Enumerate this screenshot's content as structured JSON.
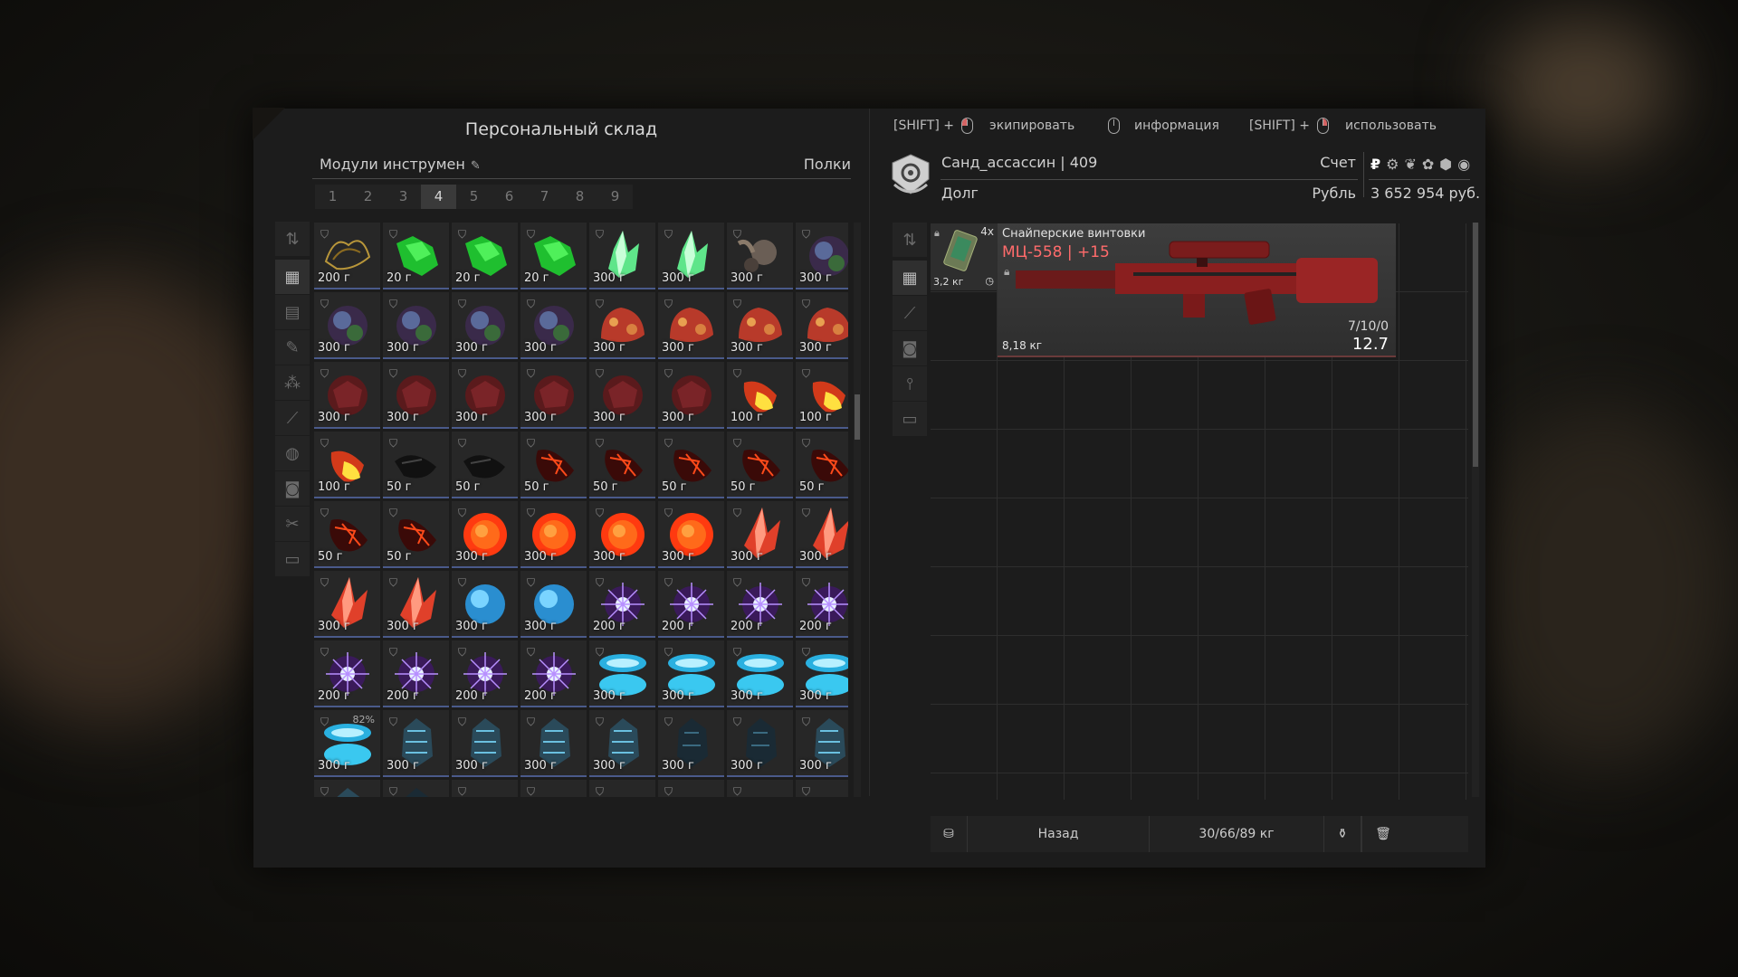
{
  "storage": {
    "title": "Персональный склад",
    "folder_name": "Модули инструмен",
    "shelves_label": "Полки",
    "pages": [
      "1",
      "2",
      "3",
      "4",
      "5",
      "6",
      "7",
      "8",
      "9"
    ],
    "active_page": "4"
  },
  "hints": {
    "equip_mod": "[SHIFT] +",
    "equip": "экипировать",
    "info": "информация",
    "use_mod": "[SHIFT] +",
    "use": "использовать"
  },
  "account": {
    "username": "Санд_ассассин | 409",
    "account_label": "Счет",
    "debt_label": "Долг",
    "currency_name": "Рубль",
    "balance": "3 652 954 руб.",
    "currency_symbol": "₽"
  },
  "equipped": {
    "small_item": {
      "qty": "4x",
      "weight": "3,2 кг"
    },
    "weapon": {
      "category": "Снайперские винтовки",
      "name": "МЦ-558 | +15",
      "weight": "8,18 кг",
      "ammo": "7/10/0",
      "caliber": "12.7"
    }
  },
  "footer": {
    "back": "Назад",
    "weight": "30/66/89 кг"
  },
  "items": [
    {
      "type": "gold",
      "price": "200 г"
    },
    {
      "type": "green",
      "price": "20 г"
    },
    {
      "type": "green",
      "price": "20 г"
    },
    {
      "type": "green",
      "price": "20 г"
    },
    {
      "type": "crystalg",
      "price": "300 г"
    },
    {
      "type": "crystalg",
      "price": "300 г"
    },
    {
      "type": "grey",
      "price": "300 г"
    },
    {
      "type": "purple",
      "price": "300 г"
    },
    {
      "type": "purple",
      "price": "300 г"
    },
    {
      "type": "purple",
      "price": "300 г"
    },
    {
      "type": "purple",
      "price": "300 г"
    },
    {
      "type": "purple",
      "price": "300 г"
    },
    {
      "type": "meat",
      "price": "300 г"
    },
    {
      "type": "meat",
      "price": "300 г"
    },
    {
      "type": "meat",
      "price": "300 г"
    },
    {
      "type": "meat",
      "price": "300 г"
    },
    {
      "type": "darkred",
      "price": "300 г"
    },
    {
      "type": "darkred",
      "price": "300 г"
    },
    {
      "type": "darkred",
      "price": "300 г"
    },
    {
      "type": "darkred",
      "price": "300 г"
    },
    {
      "type": "darkred",
      "price": "300 г"
    },
    {
      "type": "darkred",
      "price": "300 г"
    },
    {
      "type": "yellow",
      "price": "100 г"
    },
    {
      "type": "yellow",
      "price": "100 г"
    },
    {
      "type": "yellow",
      "price": "100 г"
    },
    {
      "type": "black",
      "price": "50 г"
    },
    {
      "type": "black",
      "price": "50 г"
    },
    {
      "type": "lava",
      "price": "50 г"
    },
    {
      "type": "lava",
      "price": "50 г"
    },
    {
      "type": "lava",
      "price": "50 г"
    },
    {
      "type": "lava",
      "price": "50 г"
    },
    {
      "type": "lava",
      "price": "50 г"
    },
    {
      "type": "lava",
      "price": "50 г"
    },
    {
      "type": "lava",
      "price": "50 г"
    },
    {
      "type": "fire",
      "price": "300 г"
    },
    {
      "type": "fire",
      "price": "300 г"
    },
    {
      "type": "fire",
      "price": "300 г"
    },
    {
      "type": "fire",
      "price": "300 г"
    },
    {
      "type": "crystalr",
      "price": "300 г"
    },
    {
      "type": "crystalr",
      "price": "300 г"
    },
    {
      "type": "crystalr",
      "price": "300 г"
    },
    {
      "type": "crystalr",
      "price": "300 г"
    },
    {
      "type": "bluesphere",
      "price": "300 г"
    },
    {
      "type": "bluesphere",
      "price": "300 г"
    },
    {
      "type": "spark",
      "price": "200 г"
    },
    {
      "type": "spark",
      "price": "200 г"
    },
    {
      "type": "spark",
      "price": "200 г"
    },
    {
      "type": "spark",
      "price": "200 г"
    },
    {
      "type": "spark",
      "price": "200 г"
    },
    {
      "type": "spark",
      "price": "200 г"
    },
    {
      "type": "spark",
      "price": "200 г"
    },
    {
      "type": "spark",
      "price": "200 г"
    },
    {
      "type": "ice",
      "price": "300 г"
    },
    {
      "type": "ice",
      "price": "300 г"
    },
    {
      "type": "ice",
      "price": "300 г"
    },
    {
      "type": "ice",
      "price": "300 г"
    },
    {
      "type": "ice",
      "price": "300 г",
      "pct": "82%"
    },
    {
      "type": "shard",
      "price": "300 г"
    },
    {
      "type": "shard",
      "price": "300 г"
    },
    {
      "type": "shard",
      "price": "300 г"
    },
    {
      "type": "shard",
      "price": "300 г"
    },
    {
      "type": "darkshard",
      "price": "300 г"
    },
    {
      "type": "darkshard",
      "price": "300 г"
    },
    {
      "type": "shard",
      "price": "300 г"
    },
    {
      "type": "shard",
      "price": ""
    },
    {
      "type": "darkshard",
      "price": ""
    },
    {
      "type": "star",
      "price": ""
    },
    {
      "type": "star",
      "price": ""
    },
    {
      "type": "star",
      "price": ""
    },
    {
      "type": "star",
      "price": ""
    },
    {
      "type": "star",
      "price": ""
    },
    {
      "type": "star",
      "price": ""
    }
  ],
  "colors": {
    "accent_red": "#ff6b6b",
    "cell_border": "#4a5a8a"
  }
}
